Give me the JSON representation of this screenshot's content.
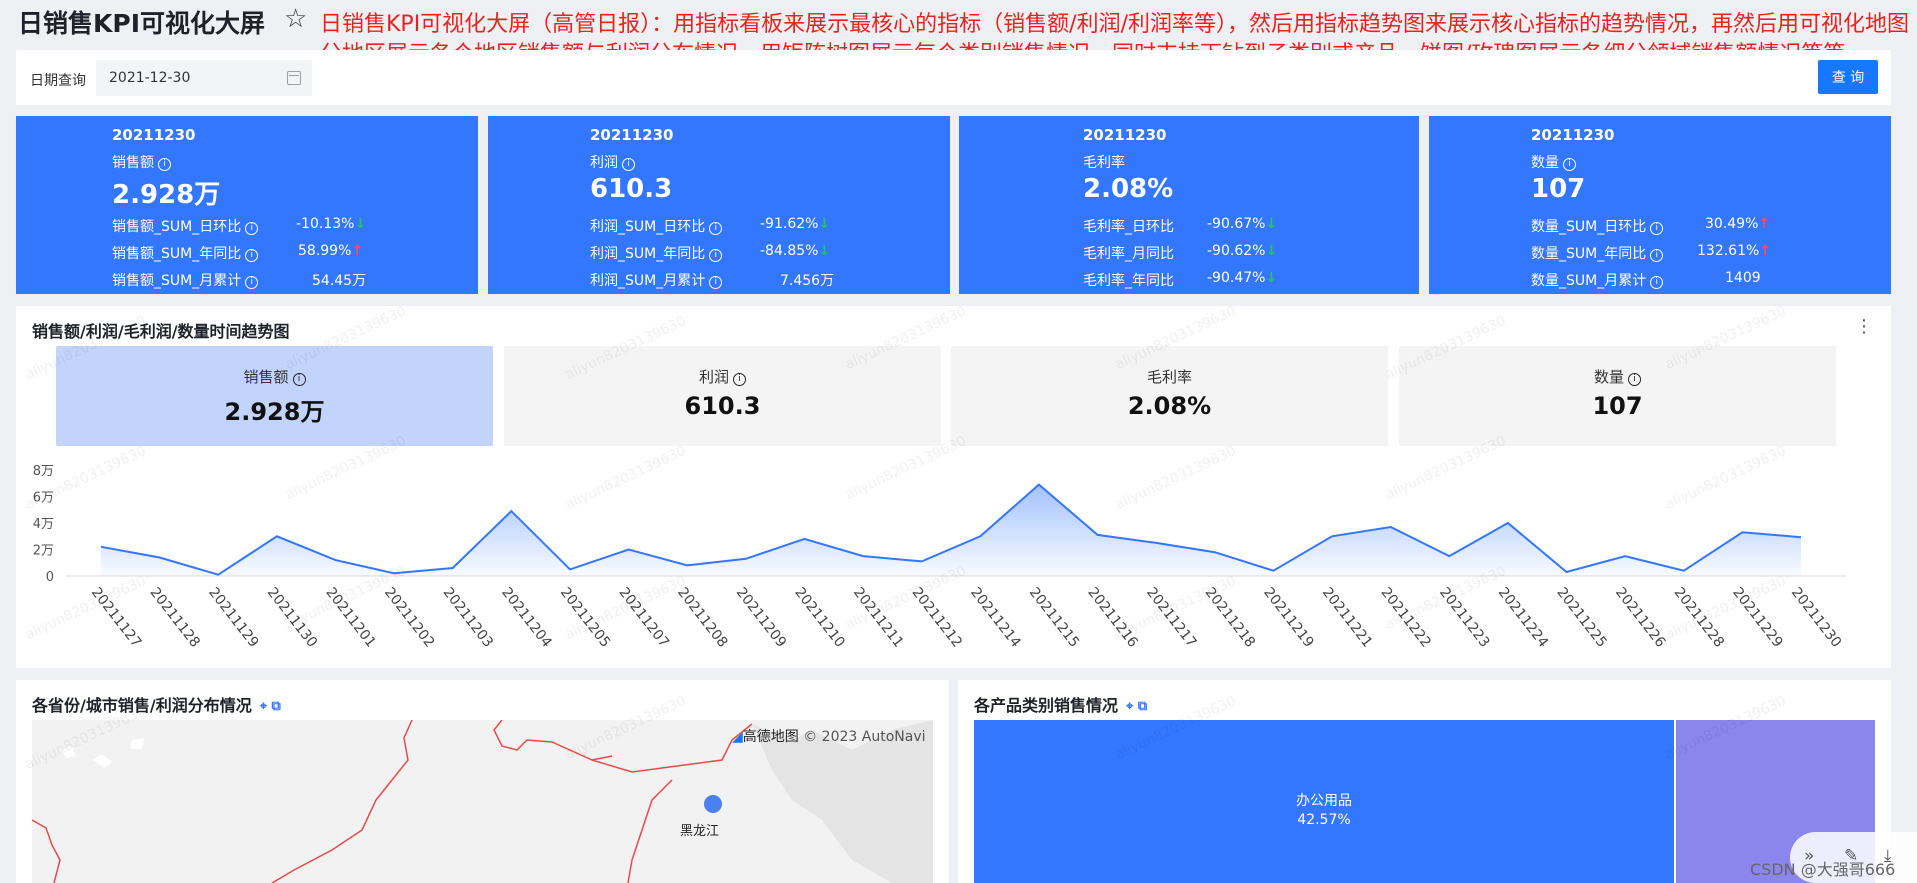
{
  "header": {
    "title": "日销售KPI可视化大屏",
    "star_icon": "star-icon",
    "annotation": "日销售KPI可视化大屏（高管日报）：用指标看板来展示最核心的指标（销售额/利润/利润率等），然后用指标趋势图来展示核心指标的趋势情况，再然后用可视化地图分地区展示各个地区销售额与利润分布情况，用矩阵树图展示每个类别销售情况，同时支持下钻到子类别或产品，饼图/玫瑰图展示各细分领域销售额情况等等。"
  },
  "filter": {
    "label": "日期查询",
    "date_value": "2021-12-30",
    "query_label": "查 询"
  },
  "kpi_cards": [
    {
      "date": "20211230",
      "label": "销售额",
      "value": "2.928万",
      "rows": [
        {
          "label": "销售额_SUM_日环比",
          "value": "-10.13%",
          "dir": "down"
        },
        {
          "label": "销售额_SUM_年同比",
          "value": "58.99%",
          "dir": "up"
        },
        {
          "label": "销售额_SUM_月累计",
          "value": "54.45万",
          "dir": ""
        }
      ]
    },
    {
      "date": "20211230",
      "label": "利润",
      "value": "610.3",
      "rows": [
        {
          "label": "利润_SUM_日环比",
          "value": "-91.62%",
          "dir": "down"
        },
        {
          "label": "利润_SUM_年同比",
          "value": "-84.85%",
          "dir": "down"
        },
        {
          "label": "利润_SUM_月累计",
          "value": "7.456万",
          "dir": ""
        }
      ]
    },
    {
      "date": "20211230",
      "label": "毛利率",
      "value": "2.08%",
      "rows": [
        {
          "label": "毛利率_日环比",
          "value": "-90.67%",
          "dir": "down"
        },
        {
          "label": "毛利率_月同比",
          "value": "-90.62%",
          "dir": "down"
        },
        {
          "label": "毛利率_年同比",
          "value": "-90.47%",
          "dir": "down"
        }
      ]
    },
    {
      "date": "20211230",
      "label": "数量",
      "value": "107",
      "rows": [
        {
          "label": "数量_SUM_日环比",
          "value": "30.49%",
          "dir": "up"
        },
        {
          "label": "数量_SUM_年同比",
          "value": "132.61%",
          "dir": "up"
        },
        {
          "label": "数量_SUM_月累计",
          "value": "1409",
          "dir": ""
        }
      ]
    }
  ],
  "trend": {
    "title": "销售额/利润/毛利润/数量时间趋势图",
    "tabs": [
      {
        "label": "销售额",
        "value": "2.928万",
        "info": true
      },
      {
        "label": "利润",
        "value": "610.3",
        "info": true
      },
      {
        "label": "毛利率",
        "value": "2.08%",
        "info": false
      },
      {
        "label": "数量",
        "value": "107",
        "info": true
      }
    ]
  },
  "chart_data": {
    "type": "area",
    "title": "",
    "xlabel": "",
    "ylabel": "",
    "x": [
      "20211127",
      "20211128",
      "20211129",
      "20211130",
      "20211201",
      "20211202",
      "20211203",
      "20211204",
      "20211205",
      "20211207",
      "20211208",
      "20211209",
      "20211210",
      "20211211",
      "20211212",
      "20211214",
      "20211215",
      "20211216",
      "20211217",
      "20211218",
      "20211219",
      "20211221",
      "20211222",
      "20211223",
      "20211224",
      "20211225",
      "20211226",
      "20211228",
      "20211229",
      "20211230"
    ],
    "series": [
      {
        "values": [
          2.2,
          1.4,
          0.1,
          3.0,
          1.2,
          0.2,
          0.6,
          4.9,
          0.5,
          2.0,
          0.8,
          1.3,
          2.8,
          1.5,
          1.1,
          3.0,
          6.9,
          3.1,
          2.5,
          1.8,
          0.4,
          3.0,
          3.7,
          1.5,
          4.0,
          0.3,
          1.5,
          0.4,
          3.3,
          2.928
        ]
      }
    ],
    "y_ticks": [
      "0",
      "2万",
      "4万",
      "6万",
      "8万"
    ],
    "ylim": [
      0,
      8
    ],
    "color": "#3377ff"
  },
  "map": {
    "title": "各省份/城市销售/利润分布情况",
    "attribution": "© 2023 AutoNavi",
    "logo": "高德地图",
    "region_label": "黑龙江"
  },
  "treemap": {
    "title": "各产品类别销售情况",
    "items": [
      {
        "label": "办公用品",
        "pct": "42.57%",
        "color": "#3377ff"
      },
      {
        "color": "#8b86ee"
      }
    ]
  },
  "watermark": "aliyun8203139630",
  "footer": {
    "credit": "CSDN @大强哥666"
  }
}
